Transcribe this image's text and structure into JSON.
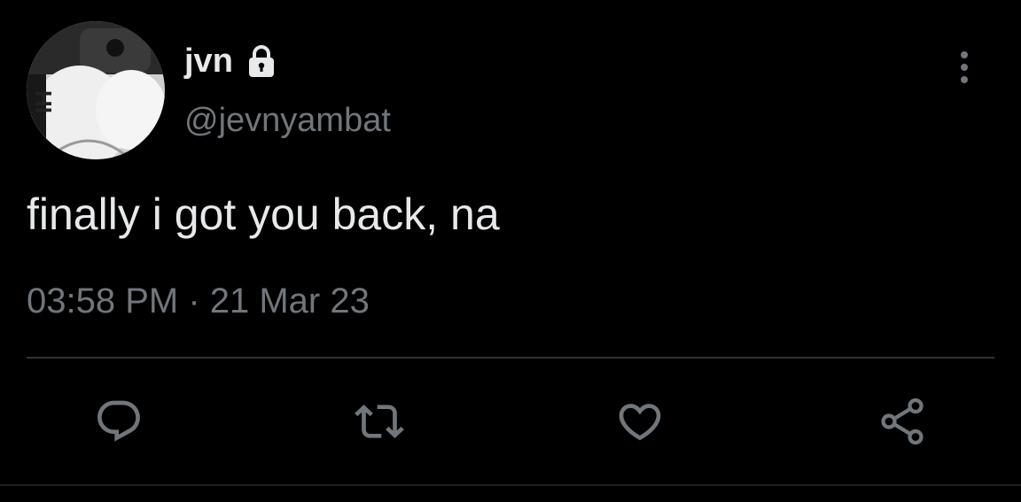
{
  "user": {
    "display_name": "jvn",
    "handle": "@jevnyambat",
    "protected": true,
    "avatar_icon": "avatar-photo"
  },
  "tweet": {
    "text": "finally i got you back, na",
    "timestamp": "03:58 PM · 21 Mar 23"
  },
  "actions": [
    {
      "icon": "reply-icon"
    },
    {
      "icon": "retweet-icon"
    },
    {
      "icon": "like-icon"
    },
    {
      "icon": "share-icon"
    }
  ],
  "colors": {
    "background": "#000000",
    "primary_text": "#e7e9ea",
    "secondary_text": "#71767b",
    "divider": "#2f3336"
  }
}
